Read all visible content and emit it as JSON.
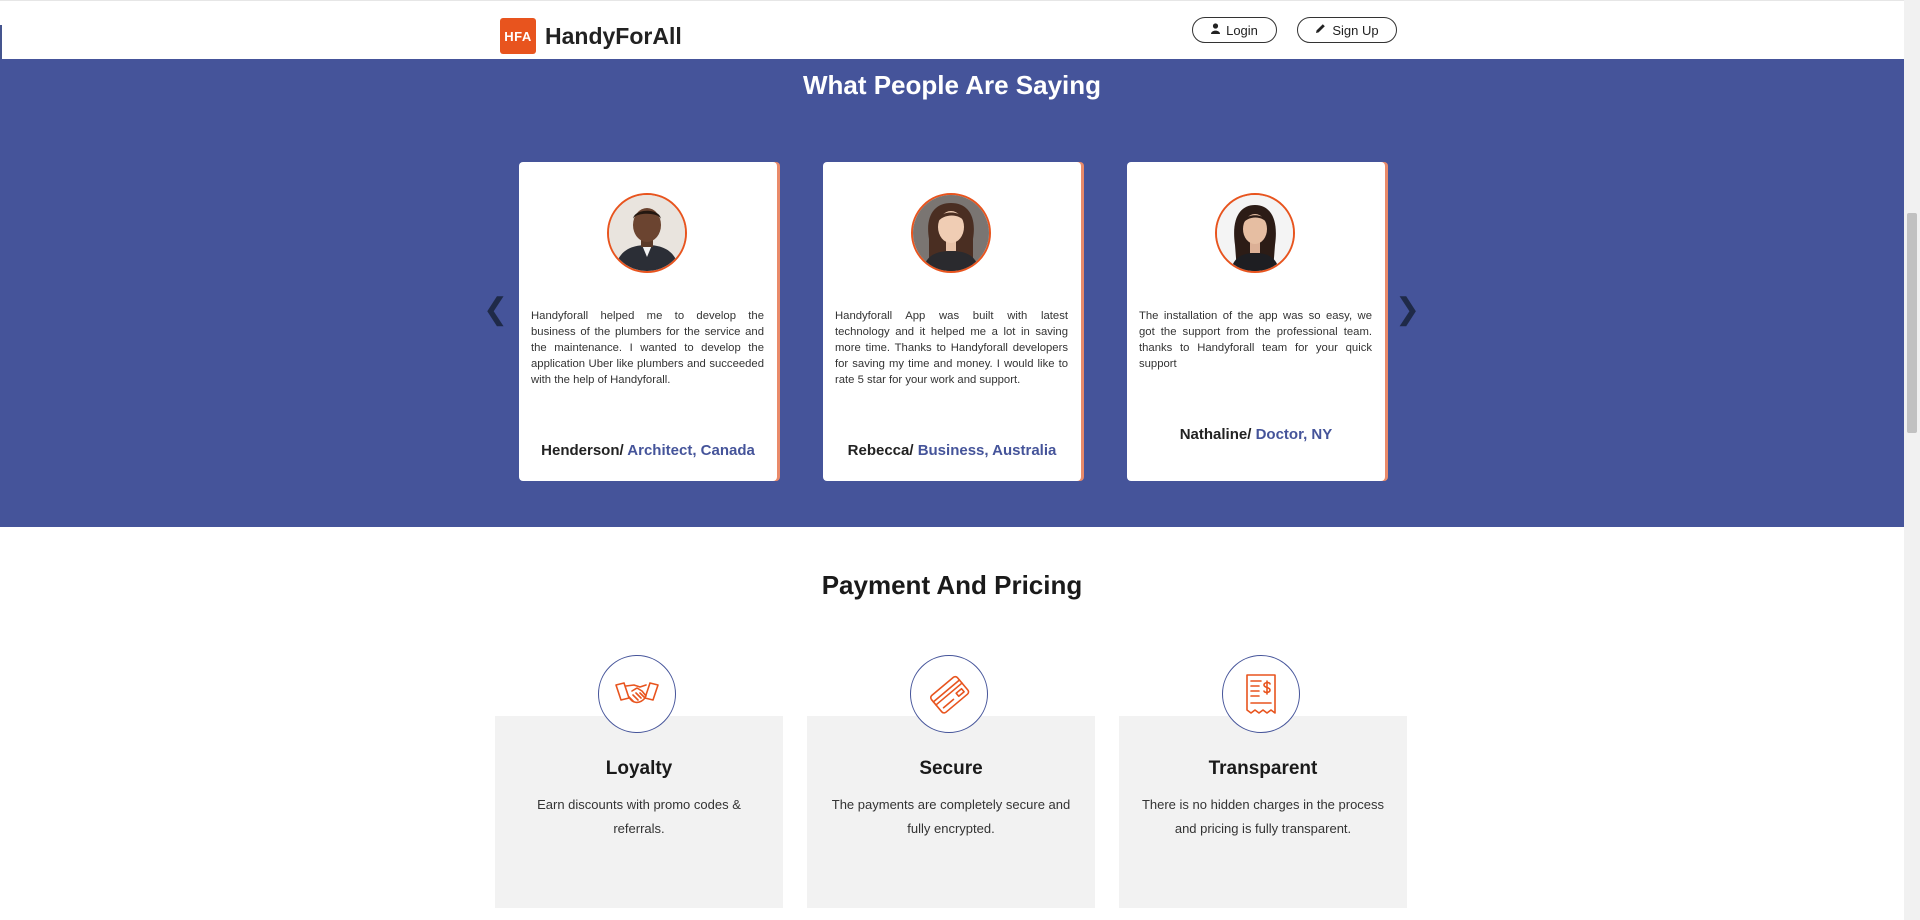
{
  "header": {
    "logo_badge": "HFA",
    "brand": "HandyForAll",
    "login_label": "Login",
    "signup_label": "Sign Up"
  },
  "testimonials": {
    "title": "What People Are Saying",
    "prev_arrow": "❮",
    "next_arrow": "❯",
    "items": [
      {
        "quote": "Handyforall helped me to develop the business of the plumbers for the service and the maintenance. I wanted to develop the application Uber like plumbers and succeeded with the help of Handyforall.",
        "name": "Henderson/",
        "role": "Architect, Canada"
      },
      {
        "quote": "Handyforall App was built with latest technology and it helped me a lot in saving more time. Thanks to Handyforall developers for saving my time and money. I would like to rate 5 star for your work and support.",
        "name": "Rebecca/",
        "role": "Business, Australia"
      },
      {
        "quote": "The installation of the app was so easy, we got the support from the professional team. thanks to Handyforall team for your quick support",
        "name": "Nathaline/",
        "role": "Doctor, NY"
      }
    ]
  },
  "pricing": {
    "title": "Payment And Pricing",
    "items": [
      {
        "icon": "handshake-icon",
        "title": "Loyalty",
        "text": "Earn discounts with promo codes & referrals."
      },
      {
        "icon": "credit-card-icon",
        "title": "Secure",
        "text": "The payments are completely secure and fully encrypted."
      },
      {
        "icon": "receipt-icon",
        "title": "Transparent",
        "text": "There is no hidden charges in the process and pricing is fully transparent."
      }
    ]
  },
  "colors": {
    "brand_orange": "#e8541e",
    "section_blue": "#45549a",
    "card_gray": "#f2f2f2"
  }
}
